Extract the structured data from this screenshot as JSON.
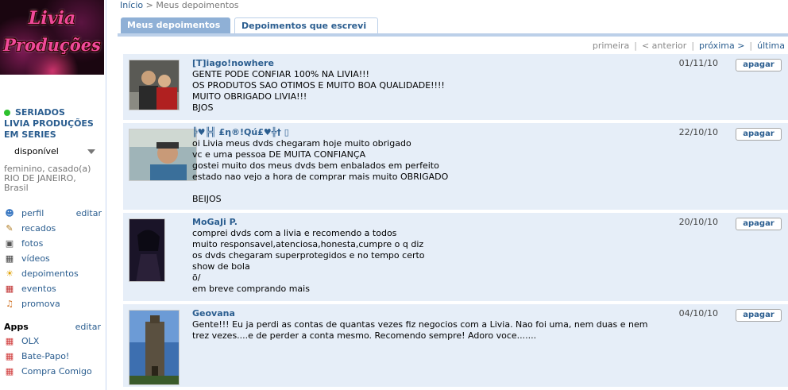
{
  "sidebar": {
    "logo_line1": "Livia",
    "logo_line2": "Produções",
    "profile_name": "SERIADOS\nLIVIA PRODUÇÕES\nEM SERIES",
    "status": "disponível",
    "info": "feminino, casado(a)\nRIO DE JANEIRO,\nBrasil",
    "profile_edit": "editar",
    "nav": [
      {
        "label": "perfil",
        "icon": "person-icon"
      },
      {
        "label": "recados",
        "icon": "note-icon"
      },
      {
        "label": "fotos",
        "icon": "photo-icon"
      },
      {
        "label": "vídeos",
        "icon": "film-icon"
      },
      {
        "label": "depoimentos",
        "icon": "sun-icon"
      },
      {
        "label": "eventos",
        "icon": "calendar-icon"
      },
      {
        "label": "promova",
        "icon": "megaphone-icon"
      }
    ],
    "apps_title": "Apps",
    "apps_edit": "editar",
    "apps": [
      {
        "label": "OLX",
        "icon": "cube-icon"
      },
      {
        "label": "Bate-Papo!",
        "icon": "cube-icon"
      },
      {
        "label": "Compra Comigo",
        "icon": "cube-icon"
      }
    ]
  },
  "breadcrumb": {
    "home": "Início",
    "separator": ">",
    "current": "Meus depoimentos"
  },
  "tabs": {
    "mine": "Meus depoimentos",
    "written": "Depoimentos que escrevi"
  },
  "pager": {
    "first": "primeira",
    "prev": "< anterior",
    "next": "próxima >",
    "last": "última"
  },
  "delete_label": "apagar",
  "entries": [
    {
      "author": "[T]iago!nowhere",
      "date": "01/11/10",
      "body": "GENTE PODE CONFIAR 100% NA LIVIA!!!\nOS PRODUTOS SAO OTIMOS E MUITO BOA QUALIDADE!!!!\nMUITO OBRIGADO LIVIA!!!\nBJOS"
    },
    {
      "author": "╠♥╠╣ £η®!Qú£♥╬† ▯",
      "date": "22/10/10",
      "body": "oi Livia meus dvds chegaram hoje muito obrigado\nvc e uma pessoa DE MUITA CONFIANÇA\ngostei muito dos meus dvds bem enbalados em perfeito\nestado nao vejo a hora de comprar mais muito OBRIGADO\n\nBEIJOS"
    },
    {
      "author": "MoGaJi P.",
      "date": "20/10/10",
      "body": "comprei dvds com a livia e recomendo a todos\nmuito responsavel,atenciosa,honesta,cumpre o q diz\nos dvds chegaram superprotegidos e no tempo certo\nshow de bola\nõ/\nem breve comprando mais"
    },
    {
      "author": "Geovana",
      "date": "04/10/10",
      "body": "Gente!!! Eu ja perdi as contas de quantas vezes fiz negocios com a Livia. Nao foi uma, nem duas e nem trez vezes....e de perder a conta mesmo. Recomendo sempre! Adoro voce......."
    }
  ]
}
